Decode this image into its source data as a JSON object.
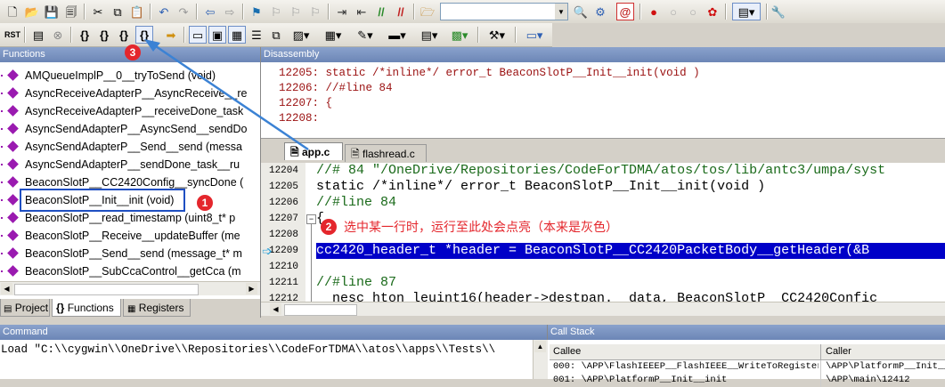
{
  "functions_panel": {
    "title": "Functions",
    "items": [
      "AMQueueImplP__0__tryToSend (void)",
      "AsyncReceiveAdapterP__AsyncReceive__re",
      "AsyncReceiveAdapterP__receiveDone_task",
      "AsyncSendAdapterP__AsyncSend__sendDo",
      "AsyncSendAdapterP__Send__send (messa",
      "AsyncSendAdapterP__sendDone_task__ru",
      "BeaconSlotP__CC2420Config__syncDone (",
      "BeaconSlotP__Init__init (void)",
      "BeaconSlotP__read_timestamp (uint8_t* p",
      "BeaconSlotP__Receive__updateBuffer (me",
      "BeaconSlotP__Send__send (message_t* m",
      "BeaconSlotP__SubCcaControl__getCca (m"
    ],
    "tabs": [
      "Project",
      "Functions",
      "Registers"
    ]
  },
  "disassembly": {
    "title": "Disassembly",
    "lines": [
      "12205: static  /*inline*/  error_t BeaconSlotP__Init__init(void )",
      "12206: //#line 84",
      "12207: {",
      "12208:"
    ]
  },
  "editor": {
    "tabs": [
      "app.c",
      "flashread.c"
    ],
    "lines": [
      {
        "num": "12204",
        "code": "//# 84 \"/OneDrive/Repositories/CodeForTDMA/atos/tos/lib/antc3/umpa/syst"
      },
      {
        "num": "12205",
        "code": "static  /*inline*/  error_t BeaconSlotP__Init__init(void )"
      },
      {
        "num": "12206",
        "code": "//#line 84"
      },
      {
        "num": "12207",
        "code": "{"
      },
      {
        "num": "12208",
        "code": ""
      },
      {
        "num": "12209",
        "code": "  cc2420_header_t *header = BeaconSlotP__CC2420PacketBody__getHeader(&B"
      },
      {
        "num": "12210",
        "code": ""
      },
      {
        "num": "12211",
        "code": "//#line 87"
      },
      {
        "num": "12212",
        "code": "  __nesc_hton_leuint16(header->destpan.__data, BeaconSlotP__CC2420Confic"
      }
    ]
  },
  "annotations": {
    "badge1": "1",
    "badge2": "2",
    "badge3": "3",
    "note2": "选中某一行时，运行至此处会点亮（本来是灰色）"
  },
  "command": {
    "title": "Command",
    "text": "Load \"C:\\\\cygwin\\\\OneDrive\\\\Repositories\\\\CodeForTDMA\\\\atos\\\\apps\\\\Tests\\\\"
  },
  "call_stack": {
    "title": "Call Stack",
    "headers": [
      "Callee",
      "Caller"
    ],
    "rows": [
      [
        "000: \\APP\\FlashIEEEP__FlashIEEE__WriteToRegister",
        "\\APP\\PlatformP__Init__i"
      ],
      [
        "001: \\APP\\PlatformP__Init__init",
        "\\APP\\main\\12412"
      ]
    ]
  },
  "colors": {
    "highlight": "#0000c8",
    "annotation": "#e4262c",
    "arrow": "#3b82d4",
    "panel_title": "#7891c2"
  }
}
